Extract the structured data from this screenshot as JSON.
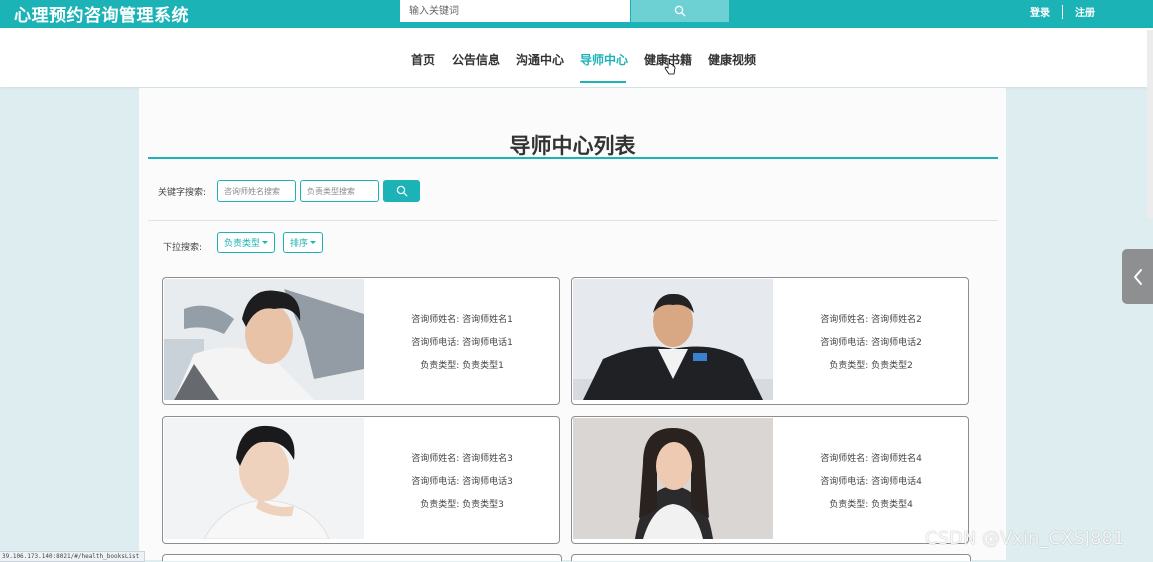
{
  "header": {
    "brand": "心理预约咨询管理系统",
    "search_placeholder": "输入关键词",
    "login": "登录",
    "register": "注册"
  },
  "nav": {
    "items": [
      "首页",
      "公告信息",
      "沟通中心",
      "导师中心",
      "健康书籍",
      "健康视频"
    ],
    "active": "导师中心"
  },
  "page": {
    "title": "导师中心列表",
    "keyword_label": "关键字搜索:",
    "keyword_inputs": [
      "咨询师姓名搜索",
      "负责类型搜索"
    ],
    "dropdown_label": "下拉搜索:",
    "dropdowns": [
      "负责类型",
      "排序"
    ]
  },
  "cards": [
    {
      "rows": [
        "咨询师姓名: 咨询师姓名1",
        "咨询师电话: 咨询师电话1",
        "负责类型: 负责类型1"
      ]
    },
    {
      "rows": [
        "咨询师姓名: 咨询师姓名2",
        "咨询师电话: 咨询师电话2",
        "负责类型: 负责类型2"
      ]
    },
    {
      "rows": [
        "咨询师姓名: 咨询师姓名3",
        "咨询师电话: 咨询师电话3",
        "负责类型: 负责类型3"
      ]
    },
    {
      "rows": [
        "咨询师姓名: 咨询师姓名4",
        "咨询师电话: 咨询师电话4",
        "负责类型: 负责类型4"
      ]
    }
  ],
  "status_url": "39.106.173.140:8021/#/health_booksList",
  "watermark": "CSDN @Vxin_CXSJ881",
  "colors": {
    "accent": "#1bb3b6",
    "page_bg": "#deeef0",
    "panel_bg": "#fcfbfc"
  },
  "icons": {
    "search": "search-icon",
    "side_toggle": "chevron-left-icon"
  }
}
